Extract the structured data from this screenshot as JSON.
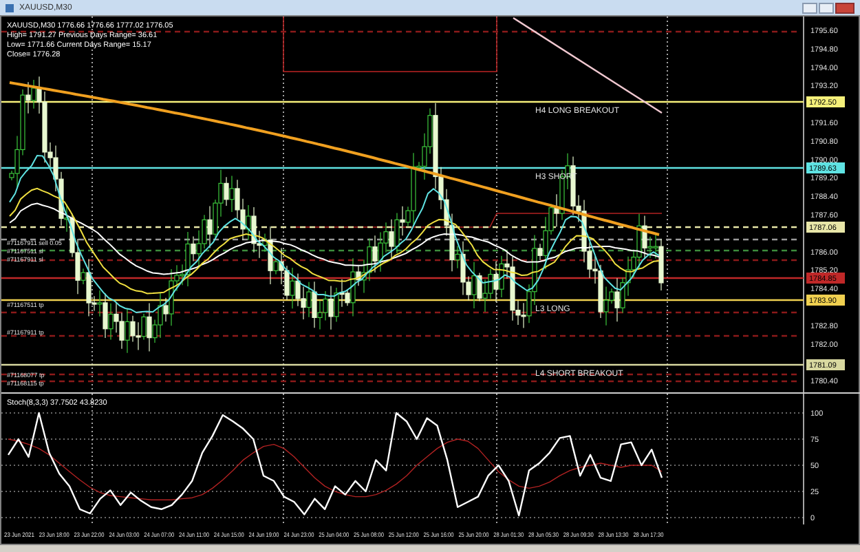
{
  "window": {
    "title": "XAUUSD,M30"
  },
  "info_lines": [
    "XAUUSD,M30  1776.66 1776.66 1777.02 1776.05",
    "High= 1791.27   Previous Days Range= 36.61",
    "Low= 1771.66   Current Days Range= 15.17",
    "Close= 1776.28"
  ],
  "price_axis": [
    "1795.60",
    "1794.80",
    "1794.00",
    "1793.20",
    "1791.60",
    "1790.80",
    "1790.00",
    "1789.20",
    "1788.40",
    "1787.60",
    "1786.00",
    "1785.20",
    "1784.40",
    "1782.80",
    "1782.00",
    "1780.40"
  ],
  "levels": [
    {
      "color": "#8b1a1a"
    },
    {
      "color": "#f5f07a",
      "tag": "1792.50",
      "label": "H4 LONG BREAKOUT"
    },
    {
      "color": "#5fe3e3",
      "tag": "1789.63",
      "label": "H3 SHORT"
    },
    {
      "color": "#e8e6a8",
      "tag": "1787.06"
    },
    {
      "color": "#9a9a9a"
    },
    {
      "color": "#3c8c3c"
    },
    {
      "color": "#8b1a1a"
    },
    {
      "color": "#c02828",
      "tag": "1784.85"
    },
    {
      "color": "#f0d050",
      "tag": "1783.90",
      "label": "L3 LONG"
    },
    {
      "color": "#8b1a1a"
    },
    {
      "color": "#8b1a1a"
    },
    {
      "color": "#d8d8a0",
      "tag": "1781.09",
      "label": "L4 SHORT BREAKOUT"
    },
    {
      "color": "#8b1a1a"
    },
    {
      "color": "#8b1a1a"
    }
  ],
  "order_labels": [
    "#71167911 sell 0.05",
    "#71167511 sl",
    "#71167911 sl",
    "#71167511 tp",
    "#71167911 tp",
    "#71168077 tp",
    "#71168115 tp"
  ],
  "oscillator": {
    "title": "Stoch(8,3,3) 37.7502 43.8230",
    "axis": [
      "100",
      "75",
      "50",
      "25",
      "0"
    ],
    "chart_data": {
      "type": "line",
      "grid": true,
      "ylim": [
        0,
        100
      ],
      "yticks": [
        0,
        25,
        50,
        75,
        100
      ],
      "series": [
        {
          "color": "#ffffff",
          "values": [
            60,
            75,
            58,
            100,
            62,
            42,
            30,
            8,
            4,
            18,
            26,
            12,
            24,
            16,
            10,
            8,
            12,
            22,
            35,
            62,
            78,
            98,
            92,
            85,
            75,
            40,
            35,
            20,
            15,
            3,
            18,
            8,
            30,
            22,
            35,
            25,
            55,
            45,
            100,
            92,
            75,
            95,
            88,
            55,
            10,
            15,
            20,
            40,
            50,
            35,
            2,
            45,
            52,
            62,
            76,
            78,
            40,
            60,
            38,
            35,
            70,
            72,
            50,
            65,
            38
          ]
        },
        {
          "color": "#b22222",
          "values": [
            75,
            73,
            70,
            66,
            60,
            52,
            44,
            36,
            29,
            24,
            21,
            20,
            19,
            18,
            17,
            17,
            17,
            18,
            19,
            22,
            28,
            36,
            45,
            55,
            62,
            68,
            70,
            66,
            58,
            48,
            38,
            30,
            25,
            22,
            20,
            20,
            22,
            26,
            32,
            40,
            50,
            58,
            66,
            72,
            75,
            73,
            66,
            55,
            44,
            36,
            30,
            28,
            30,
            34,
            40,
            45,
            48,
            50,
            52,
            50,
            48,
            50,
            50,
            50,
            44
          ]
        }
      ]
    }
  },
  "time_axis": [
    "23 Jun 2021",
    "23 Jun 18:00",
    "23 Jun 22:00",
    "24 Jun 03:00",
    "24 Jun 07:00",
    "24 Jun 11:00",
    "24 Jun 15:00",
    "24 Jun 19:00",
    "24 Jun 23:00",
    "25 Jun 04:00",
    "25 Jun 08:00",
    "25 Jun 12:00",
    "25 Jun 16:00",
    "25 Jun 20:00",
    "28 Jun 01:30",
    "28 Jun 05:30",
    "28 Jun 09:30",
    "28 Jun 13:30",
    "28 Jun 17:30"
  ]
}
